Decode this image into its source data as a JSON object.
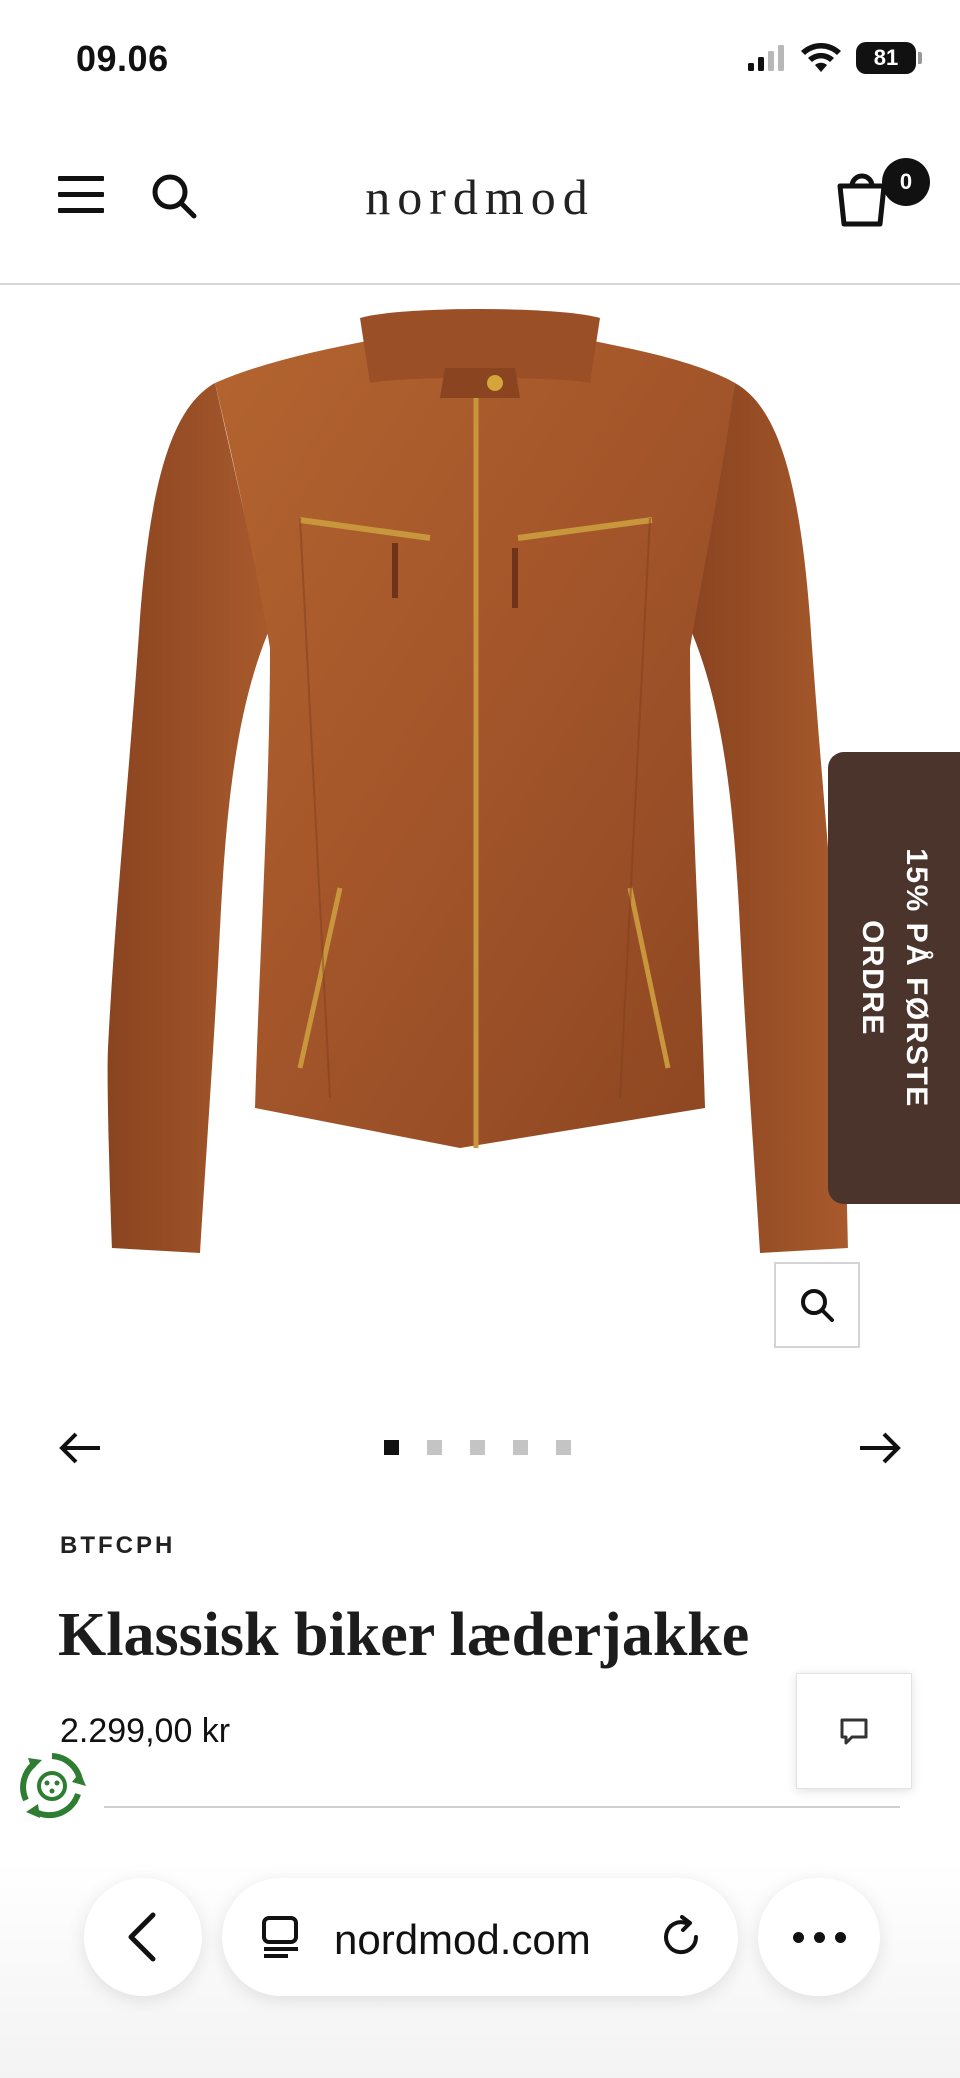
{
  "status_bar": {
    "time": "09.06",
    "battery": "81",
    "icons": [
      "signal-icon",
      "wifi-icon",
      "battery-icon"
    ]
  },
  "header": {
    "logo": "nordmod",
    "cart_count": "0",
    "icons": [
      "menu-icon",
      "search-icon",
      "cart-icon"
    ]
  },
  "promo": {
    "label": "15% PÅ FØRSTE ORDRE",
    "color": "#4a342c"
  },
  "carousel": {
    "slide_count": 5,
    "active_index": 0
  },
  "product": {
    "brand": "BTFCPH",
    "title": "Klassisk biker læderjakke",
    "price": "2.299,00 kr",
    "image_color": "#a8582b"
  },
  "browser": {
    "url": "nordmod.com"
  }
}
